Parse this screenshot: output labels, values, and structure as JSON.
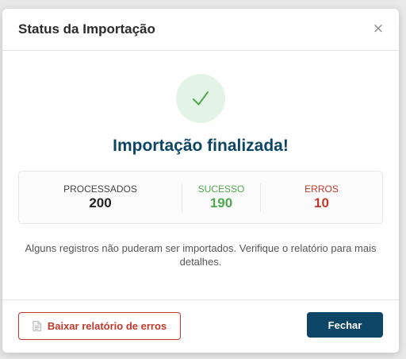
{
  "modal": {
    "title": "Status da Importação",
    "close_symbol": "×"
  },
  "result": {
    "icon": "check-icon",
    "title": "Importação finalizada!",
    "accent_color": "#4ea84e"
  },
  "stats": [
    {
      "label": "PROCESSADOS",
      "value": "200",
      "color": "#222222"
    },
    {
      "label": "SUCESSO",
      "value": "190",
      "color": "#4ea84e"
    },
    {
      "label": "ERROS",
      "value": "10",
      "color": "#c0392b"
    }
  ],
  "notice": "Alguns registros não puderam ser importados. Verifique o relatório para mais detalhes.",
  "footer": {
    "report_button": {
      "label": "Baixar relatório de erros",
      "icon": "document-icon",
      "color": "#c0392b"
    },
    "close_button": {
      "label": "Fechar",
      "color": "#0c4566"
    }
  }
}
